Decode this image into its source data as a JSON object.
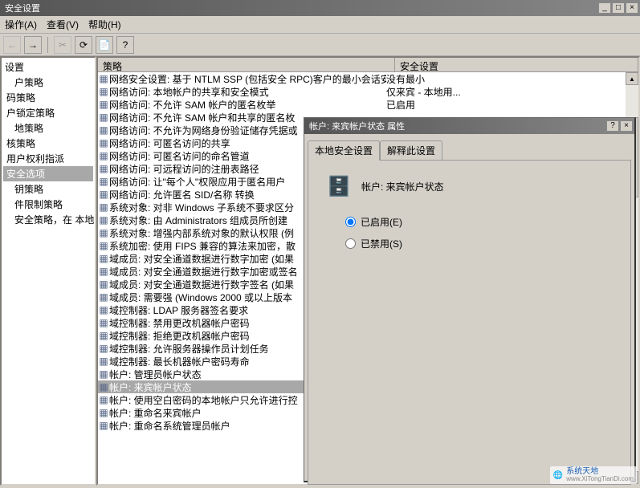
{
  "window": {
    "title": "安全设置"
  },
  "menu": {
    "action": "操作(A)",
    "view": "查看(V)",
    "help": "帮助(H)"
  },
  "tree": {
    "root": "设置",
    "items": [
      "户策略",
      "码策略",
      "户锁定策略",
      "地策略",
      "核策略",
      "用户权利指派",
      "安全选项",
      "钥策略",
      "件限制策略",
      "安全策略，在 本地"
    ]
  },
  "list": {
    "col_policy": "策略",
    "col_setting": "安全设置",
    "rows": [
      {
        "p": "网络安全设置: 基于 NTLM SSP (包括安全 RPC)客户的最小会话安全",
        "s": "没有最小"
      },
      {
        "p": "网络访问: 本地帐户的共享和安全模式",
        "s": "仅来宾 - 本地用..."
      },
      {
        "p": "网络访问: 不允许 SAM 帐户的匿名枚举",
        "s": "已启用"
      },
      {
        "p": "网络访问: 不允许 SAM 帐户和共享的匿名枚",
        "s": ""
      },
      {
        "p": "网络访问: 不允许为网络身份验证储存凭据或",
        "s": ""
      },
      {
        "p": "网络访问: 可匿名访问的共享",
        "s": ""
      },
      {
        "p": "网络访问: 可匿名访问的命名管道",
        "s": ""
      },
      {
        "p": "网络访问: 可远程访问的注册表路径",
        "s": ""
      },
      {
        "p": "网络访问: 让\"每个人\"权限应用于匿名用户",
        "s": ""
      },
      {
        "p": "网络访问: 允许匿名 SID/名称 转换",
        "s": ""
      },
      {
        "p": "系统对象: 对非 Windows 子系统不要求区分",
        "s": ""
      },
      {
        "p": "系统对象: 由 Administrators 组成员所创建",
        "s": ""
      },
      {
        "p": "系统对象: 增强内部系统对象的默认权限 (例",
        "s": ""
      },
      {
        "p": "系统加密: 使用 FIPS 兼容的算法来加密，散",
        "s": ""
      },
      {
        "p": "域成员: 对安全通道数据进行数字加密 (如果",
        "s": ""
      },
      {
        "p": "域成员: 对安全通道数据进行数字加密或签名",
        "s": ""
      },
      {
        "p": "域成员: 对安全通道数据进行数字签名 (如果",
        "s": ""
      },
      {
        "p": "域成员: 需要强 (Windows 2000 或以上版本",
        "s": ""
      },
      {
        "p": "域控制器: LDAP 服务器签名要求",
        "s": ""
      },
      {
        "p": "域控制器: 禁用更改机器帐户密码",
        "s": ""
      },
      {
        "p": "域控制器: 拒绝更改机器帐户密码",
        "s": ""
      },
      {
        "p": "域控制器: 允许服务器操作员计划任务",
        "s": ""
      },
      {
        "p": "域控制器: 最长机器帐户密码寿命",
        "s": ""
      },
      {
        "p": "帐户: 管理员帐户状态",
        "s": ""
      },
      {
        "p": "帐户: 来宾帐户状态",
        "s": ""
      },
      {
        "p": "帐户: 使用空白密码的本地帐户只允许进行控",
        "s": ""
      },
      {
        "p": "帐户: 重命名来宾帐户",
        "s": ""
      },
      {
        "p": "帐户: 重命名系统管理员帐户",
        "s": ""
      }
    ],
    "selected_index": 24
  },
  "dialog": {
    "title": "帐户: 来宾帐户状态 属性",
    "tab_local": "本地安全设置",
    "tab_explain": "解释此设置",
    "account_label": "帐户: 来宾帐户状态",
    "enabled_label": "已启用(E)",
    "disabled_label": "已禁用(S)",
    "selected": "enabled"
  },
  "watermark": {
    "text": "系统天地",
    "url": "www.XiTongTianDi.com"
  }
}
